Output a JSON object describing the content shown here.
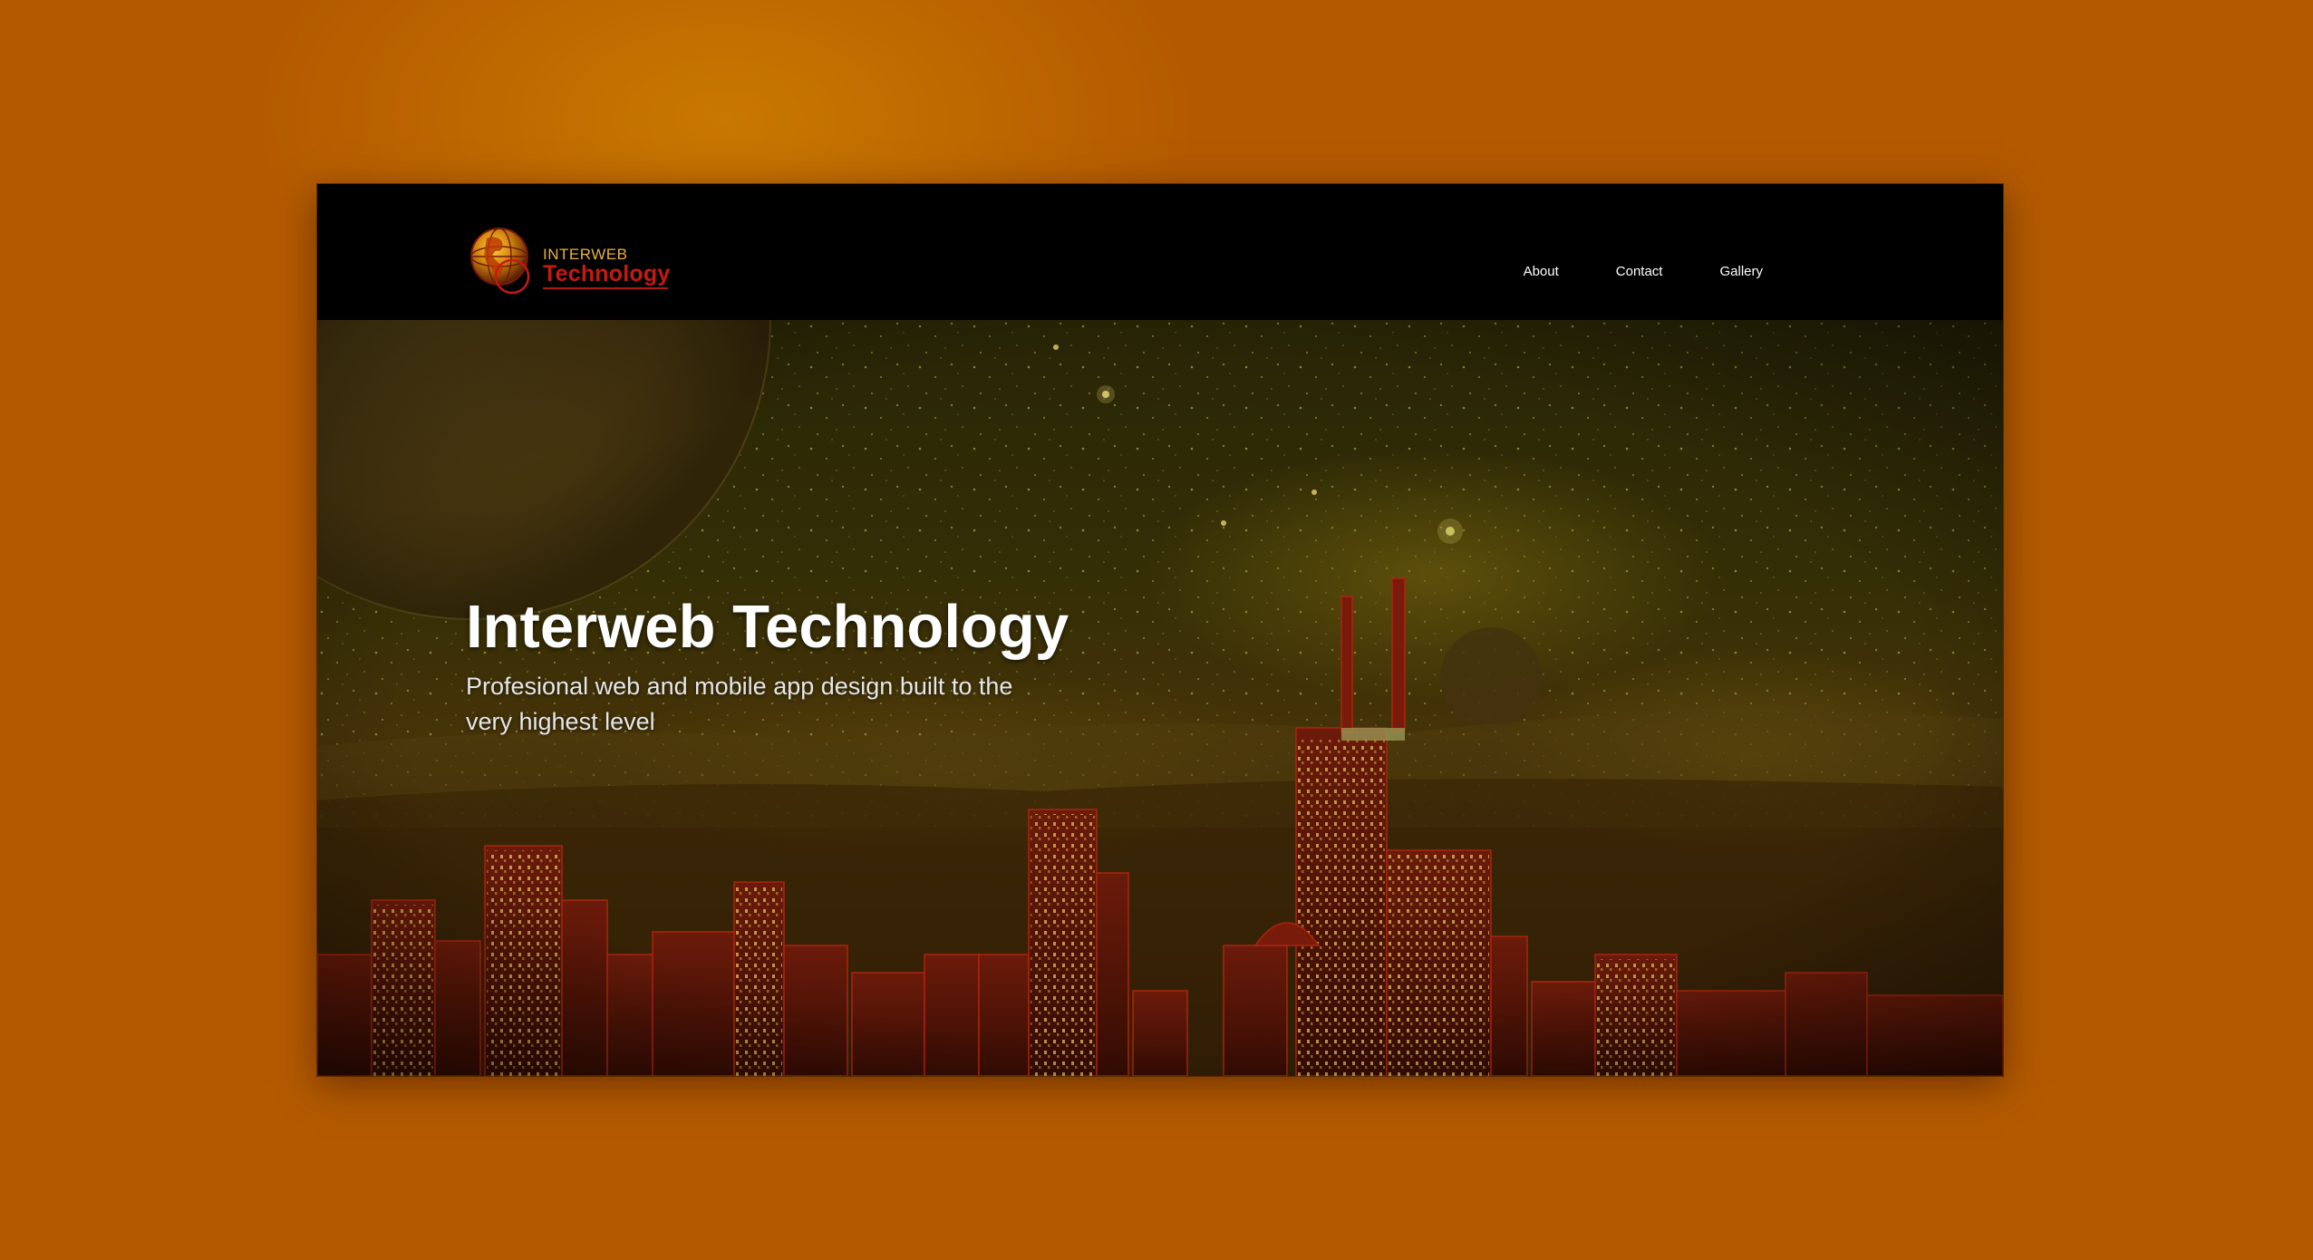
{
  "logo": {
    "alt": "Interweb Technology logo",
    "line1": "INTERWEB",
    "line2": "Technology"
  },
  "nav": {
    "items": [
      {
        "label": "About"
      },
      {
        "label": "Contact"
      },
      {
        "label": "Gallery"
      }
    ]
  },
  "hero": {
    "title": "Interweb Technology",
    "subtitle": "Profesional web and mobile app design built to the very highest level"
  },
  "colors": {
    "backdrop": "#b35a00",
    "navbar": "#000000",
    "logo_gold": "#e8b23a",
    "logo_red": "#c41a12",
    "hero_tint": "#3a2a00"
  }
}
